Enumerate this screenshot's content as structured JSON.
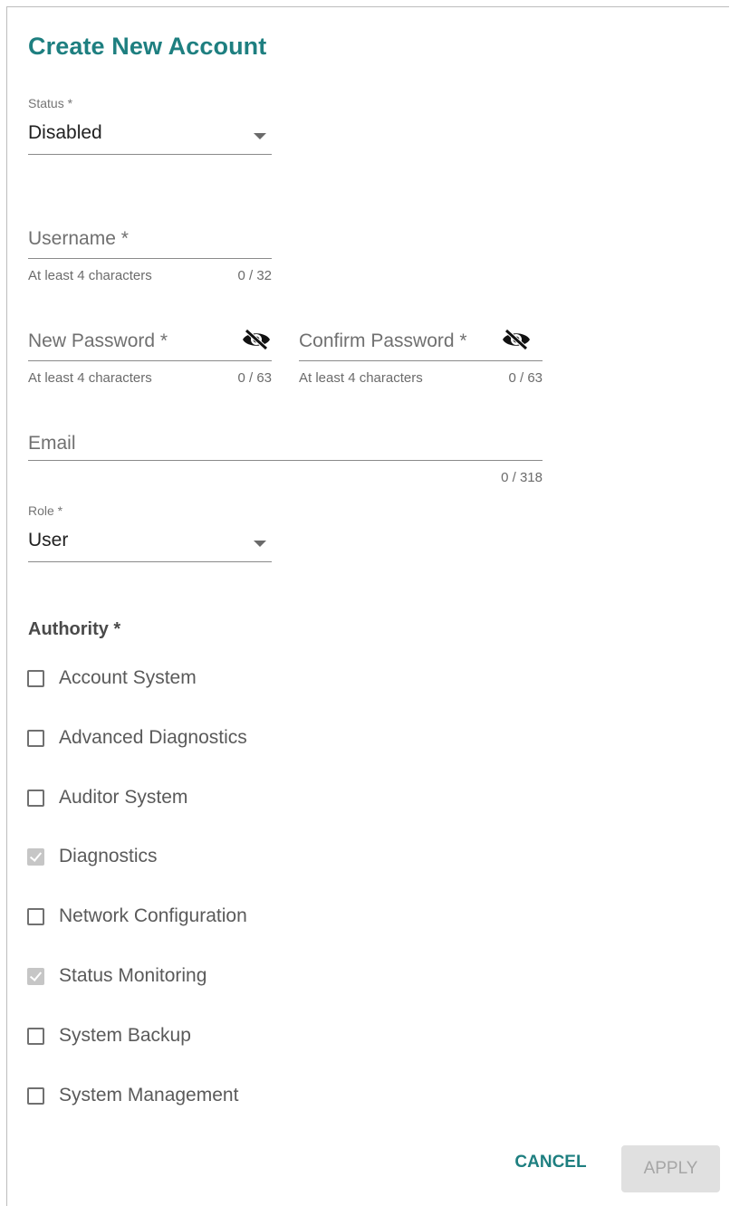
{
  "dialog": {
    "title": "Create New Account"
  },
  "status": {
    "label": "Status *",
    "value": "Disabled"
  },
  "username": {
    "placeholder": "Username *",
    "hint": "At least 4 characters",
    "counter": "0 / 32"
  },
  "new_password": {
    "placeholder": "New Password *",
    "hint": "At least 4 characters",
    "counter": "0 / 63",
    "icon": "eye-off-icon"
  },
  "confirm_password": {
    "placeholder": "Confirm Password *",
    "hint": "At least 4 characters",
    "counter": "0 / 63",
    "icon": "eye-off-icon"
  },
  "email": {
    "placeholder": "Email",
    "counter": "0 / 318"
  },
  "role": {
    "label": "Role *",
    "value": "User"
  },
  "authority": {
    "title": "Authority *",
    "items": [
      {
        "label": "Account System",
        "checked": false
      },
      {
        "label": "Advanced Diagnostics",
        "checked": false
      },
      {
        "label": "Auditor System",
        "checked": false
      },
      {
        "label": "Diagnostics",
        "checked": true
      },
      {
        "label": "Network Configuration",
        "checked": false
      },
      {
        "label": "Status Monitoring",
        "checked": true
      },
      {
        "label": "System Backup",
        "checked": false
      },
      {
        "label": "System Management",
        "checked": false
      }
    ]
  },
  "actions": {
    "cancel_label": "CANCEL",
    "apply_label": "APPLY"
  },
  "colors": {
    "accent": "#1e7f80",
    "disabled_button_bg": "#e0e0e0",
    "checked_box": "#c6c6c6"
  }
}
